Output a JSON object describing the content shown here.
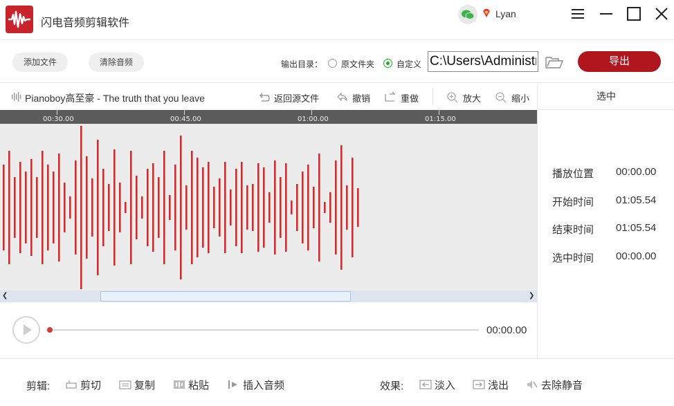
{
  "app": {
    "title": "闪电音频剪辑软件",
    "username": "Lyan"
  },
  "toolbar": {
    "add_file": "添加文件",
    "clear_audio": "清除音频",
    "output_label": "输出目录：",
    "opt_source": "原文件夹",
    "opt_custom": "自定义",
    "selected_option": "自定义",
    "path_value": "C:\\Users\\Administr",
    "export": "导出"
  },
  "editor": {
    "file_name": "Pianoboy高至豪 - The truth that you leave",
    "tools": {
      "revert": "返回源文件",
      "undo": "撤销",
      "redo": "重做",
      "zoom_in": "放大",
      "zoom_out": "缩小"
    },
    "ruler_ticks": [
      "00:30.00",
      "00:45.00",
      "01:00.00",
      "01:15.00"
    ]
  },
  "panel": {
    "title": "选中",
    "rows": [
      {
        "label": "播放位置",
        "value": "00:00.00"
      },
      {
        "label": "开始时间",
        "value": "01:05.54"
      },
      {
        "label": "结束时间",
        "value": "01:05.54"
      },
      {
        "label": "选中时间",
        "value": "00:00.00"
      }
    ]
  },
  "player": {
    "time": "00:00.00",
    "progress": 0
  },
  "bottom": {
    "edit_label": "剪辑:",
    "cut": "剪切",
    "copy": "复制",
    "paste": "粘贴",
    "insert": "插入音频",
    "effects_label": "效果:",
    "fade_in": "淡入",
    "fade_out": "浅出",
    "remove_silence": "去除静音"
  },
  "colors": {
    "accent": "#b0161e",
    "waveform": "#d42a2a",
    "radio_on": "#1aad19"
  }
}
